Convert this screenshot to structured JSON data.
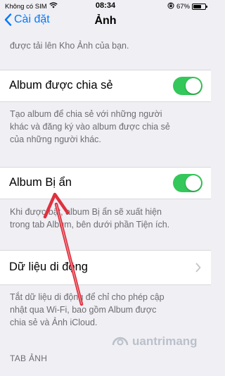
{
  "status_bar": {
    "carrier": "Không có SIM",
    "time": "08:34",
    "battery_percent": "67%",
    "battery_level": 0.67
  },
  "nav": {
    "back_label": "Cài đặt",
    "title": "Ảnh"
  },
  "top_footer": "được tải lên Kho Ảnh của bạn.",
  "shared_albums": {
    "label": "Album được chia sẻ",
    "enabled": true,
    "footer_line1": "Tạo album để chia sẻ với những người",
    "footer_line2": "khác và đăng ký vào album được chia sẻ",
    "footer_line3": "của những người khác."
  },
  "hidden_album": {
    "label": "Album Bị ẩn",
    "enabled": true,
    "footer_line1": "Khi được bật, album Bị ẩn sẽ xuất hiện",
    "footer_line2": "trong tab Album, bên dưới phần Tiện ích."
  },
  "cellular_data": {
    "label": "Dữ liệu di động",
    "footer_line1": "Tắt dữ liệu di động để chỉ cho phép cập",
    "footer_line2": "nhật qua Wi-Fi, bao gồm Album được",
    "footer_line3": "chia sẻ và Ảnh iCloud."
  },
  "photos_tab_header": "TAB ẢNH",
  "watermark": "uantrimang",
  "colors": {
    "accent": "#007aff",
    "toggle_on": "#34c759",
    "arrow": "#e0303e",
    "background": "#efeff4"
  }
}
